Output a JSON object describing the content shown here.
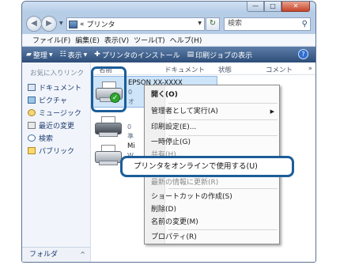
{
  "window": {
    "controls": {
      "minimize": "—",
      "maximize": "□",
      "close": "✕"
    }
  },
  "address": {
    "back_glyph": "◀",
    "forward_glyph": "▶",
    "prefix": "«",
    "path": "プリンタ",
    "search_placeholder": "検索"
  },
  "menu": [
    "ファイル(F)",
    "編集(E)",
    "表示(V)",
    "ツール(T)",
    "ヘルプ(H)"
  ],
  "toolbar": {
    "organize": "整理",
    "view": "表示",
    "add_printer": "プリンタのインストール",
    "print_jobs": "印刷ジョブの表示",
    "help": "?"
  },
  "sidebar": {
    "favorites_header": "お気に入りリンク",
    "items": [
      {
        "label": "ドキュメント",
        "icon": "documents-icon"
      },
      {
        "label": "ピクチャ",
        "icon": "pictures-icon"
      },
      {
        "label": "ミュージック",
        "icon": "music-icon"
      },
      {
        "label": "最近の変更",
        "icon": "recent-icon"
      },
      {
        "label": "検索",
        "icon": "search-icon"
      },
      {
        "label": "パブリック",
        "icon": "public-icon"
      }
    ],
    "folders_label": "フォルダ",
    "folders_arrow": "^"
  },
  "columns": {
    "name": "名前",
    "documents": "ドキュメント",
    "status": "状態",
    "comment": "コメント",
    "more": "»"
  },
  "printers": [
    {
      "name": "EPSON XX-XXXX",
      "docs": "0",
      "status": "オ"
    },
    {
      "name": "",
      "docs": "0",
      "status": "準"
    },
    {
      "name": "Mi",
      "docs": "W",
      "status": ""
    }
  ],
  "context_menu": {
    "items": [
      {
        "label": "開く(O)",
        "bold": true
      },
      {
        "label": "管理者として実行(A)",
        "submenu": "▶"
      },
      {
        "label": "印刷設定(E)..."
      },
      {
        "label": "一時停止(G)"
      },
      {
        "label": "共有(H)..."
      },
      {
        "label": "プリンタをオンラインで使用する(U)"
      },
      {
        "label": "最新の情報に更新(R)"
      },
      {
        "label": "ショートカットの作成(S)"
      },
      {
        "label": "削除(D)"
      },
      {
        "label": "名前の変更(M)"
      },
      {
        "label": "プロパティ(R)"
      }
    ]
  },
  "colors": {
    "highlight": "#1c5d98",
    "toolbar": "#3d5f8c",
    "selection": "#cde4f9"
  }
}
